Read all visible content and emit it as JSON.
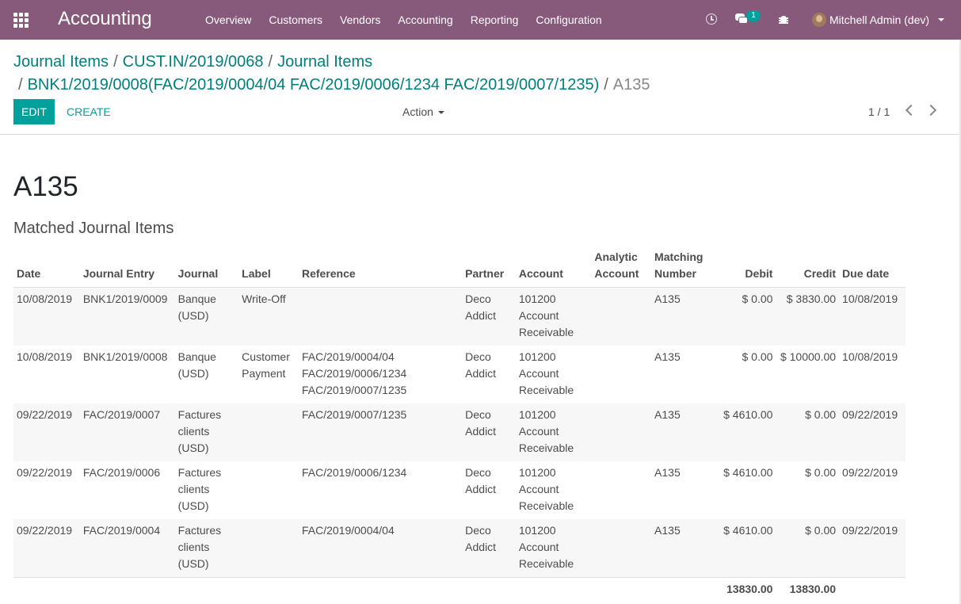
{
  "navbar": {
    "app_title": "Accounting",
    "menu": [
      "Overview",
      "Customers",
      "Vendors",
      "Accounting",
      "Reporting",
      "Configuration"
    ],
    "messages_badge": "1",
    "user": "Mitchell Admin (dev)",
    "bg_color": "#875a7b"
  },
  "breadcrumb": {
    "items": [
      "Journal Items",
      "CUST.IN/2019/0068",
      "Journal Items",
      "BNK1/2019/0008(FAC/2019/0004/04 FAC/2019/0006/1234 FAC/2019/0007/1235)"
    ],
    "current": "A135"
  },
  "toolbar": {
    "edit_label": "EDIT",
    "create_label": "CREATE",
    "action_label": "Action",
    "pager": "1 / 1"
  },
  "form": {
    "name": "A135",
    "section_title": "Matched Journal Items"
  },
  "table": {
    "headers": {
      "date": "Date",
      "journal_entry": "Journal Entry",
      "journal": "Journal",
      "label": "Label",
      "reference": "Reference",
      "partner": "Partner",
      "account": "Account",
      "analytic_account": "Analytic Account",
      "matching_number": "Matching Number",
      "debit": "Debit",
      "credit": "Credit",
      "due_date": "Due date"
    },
    "rows": [
      {
        "date": "10/08/2019",
        "entry": "BNK1/2019/0009",
        "journal": "Banque (USD)",
        "label": "Write-Off",
        "reference": "",
        "partner": "Deco Addict",
        "account": "101200 Account Receivable",
        "analytic": "",
        "matching": "A135",
        "debit": "$ 0.00",
        "credit": "$ 3830.00",
        "due": "10/08/2019"
      },
      {
        "date": "10/08/2019",
        "entry": "BNK1/2019/0008",
        "journal": "Banque (USD)",
        "label": "Customer Payment",
        "reference": "FAC/2019/0004/04 FAC/2019/0006/1234 FAC/2019/0007/1235",
        "partner": "Deco Addict",
        "account": "101200 Account Receivable",
        "analytic": "",
        "matching": "A135",
        "debit": "$ 0.00",
        "credit": "$ 10000.00",
        "due": "10/08/2019"
      },
      {
        "date": "09/22/2019",
        "entry": "FAC/2019/0007",
        "journal": "Factures clients (USD)",
        "label": "",
        "reference": "FAC/2019/0007/1235",
        "partner": "Deco Addict",
        "account": "101200 Account Receivable",
        "analytic": "",
        "matching": "A135",
        "debit": "$ 4610.00",
        "credit": "$ 0.00",
        "due": "09/22/2019"
      },
      {
        "date": "09/22/2019",
        "entry": "FAC/2019/0006",
        "journal": "Factures clients (USD)",
        "label": "",
        "reference": "FAC/2019/0006/1234",
        "partner": "Deco Addict",
        "account": "101200 Account Receivable",
        "analytic": "",
        "matching": "A135",
        "debit": "$ 4610.00",
        "credit": "$ 0.00",
        "due": "09/22/2019"
      },
      {
        "date": "09/22/2019",
        "entry": "FAC/2019/0004",
        "journal": "Factures clients (USD)",
        "label": "",
        "reference": "FAC/2019/0004/04",
        "partner": "Deco Addict",
        "account": "101200 Account Receivable",
        "analytic": "",
        "matching": "A135",
        "debit": "$ 4610.00",
        "credit": "$ 0.00",
        "due": "09/22/2019"
      }
    ],
    "totals": {
      "debit": "13830.00",
      "credit": "13830.00"
    }
  }
}
